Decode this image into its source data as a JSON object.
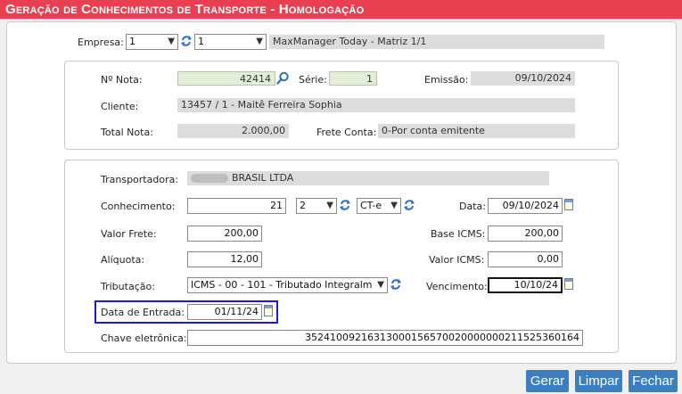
{
  "title": "Geração de Conhecimentos de Transporte  - Homologação",
  "empresa": {
    "label": "Empresa:",
    "select1": "1",
    "select2": "1",
    "name": "MaxManager Today - Matriz 1/1"
  },
  "nota": {
    "numero_label": "Nº Nota:",
    "numero": "42414",
    "serie_label": "Série:",
    "serie": "1",
    "emissao_label": "Emissão:",
    "emissao": "09/10/2024",
    "cliente_label": "Cliente:",
    "cliente": "13457 / 1 - Maitê Ferreira Sophia",
    "total_label": "Total Nota:",
    "total": "2.000,00",
    "frete_label": "Frete Conta:",
    "frete": "0-Por conta emitente"
  },
  "conhecimento": {
    "transportadora_label": "Transportadora:",
    "transportadora": "BRASIL LTDA",
    "conhecimento_label": "Conhecimento:",
    "conhecimento": "21",
    "serie_select": "2",
    "tipo_select": "CT-e",
    "data_label": "Data:",
    "data": "09/10/2024",
    "valor_frete_label": "Valor Frete:",
    "valor_frete": "200,00",
    "base_icms_label": "Base ICMS:",
    "base_icms": "200,00",
    "aliquota_label": "Alíquota:",
    "aliquota": "12,00",
    "valor_icms_label": "Valor ICMS:",
    "valor_icms": "0,00",
    "tributacao_label": "Tributação:",
    "tributacao": "ICMS - 00 - 101 - Tributado Integralm",
    "vencimento_label": "Vencimento:",
    "vencimento": "10/10/24",
    "data_entrada_label": "Data de Entrada:",
    "data_entrada": "01/11/24",
    "chave_label": "Chave eletrônica:",
    "chave": "35241009216313000156570020000000211525360164"
  },
  "buttons": {
    "gerar": "Gerar",
    "limpar": "Limpar",
    "fechar": "Fechar"
  },
  "colors": {
    "title_bar": "#e84050",
    "button": "#3a80c0",
    "highlight": "#1a1ad0"
  }
}
